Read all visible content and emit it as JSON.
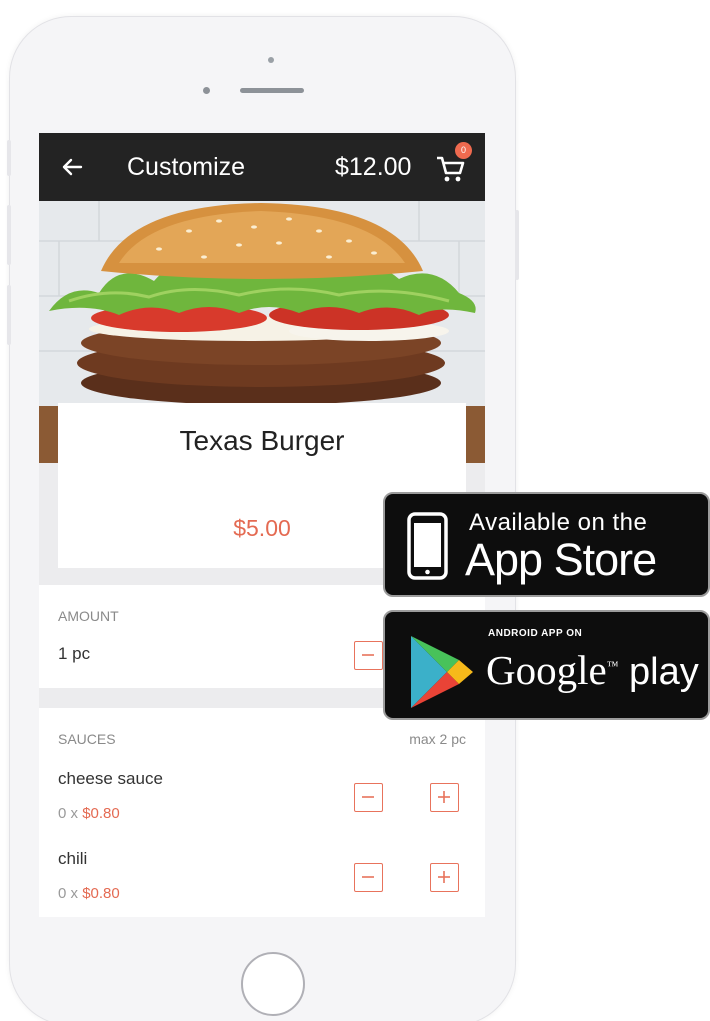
{
  "app_bar": {
    "title": "Customize",
    "total": "$12.00",
    "cart_count": "0"
  },
  "product": {
    "name": "Texas Burger",
    "price": "$5.00"
  },
  "amount": {
    "label": "AMOUNT",
    "value": "1 pc"
  },
  "sauces": {
    "label": "SAUCES",
    "max": "max 2 pc",
    "items": [
      {
        "name": "cheese sauce",
        "qty": "0 x ",
        "price": "$0.80"
      },
      {
        "name": "chili",
        "qty": "0 x ",
        "price": "$0.80"
      }
    ]
  },
  "badges": {
    "app_store": {
      "small": "Available on the",
      "big": "App Store"
    },
    "google_play": {
      "small": "ANDROID APP ON",
      "big": "Google",
      "tm": "™",
      "play": " play"
    }
  },
  "colors": {
    "accent": "#e46a52",
    "app_bar": "#232323",
    "badge_bg": "#0d0d0d"
  },
  "icons": [
    "back-arrow-icon",
    "cart-icon",
    "minus-icon",
    "plus-icon",
    "phone-icon",
    "google-play-icon"
  ]
}
